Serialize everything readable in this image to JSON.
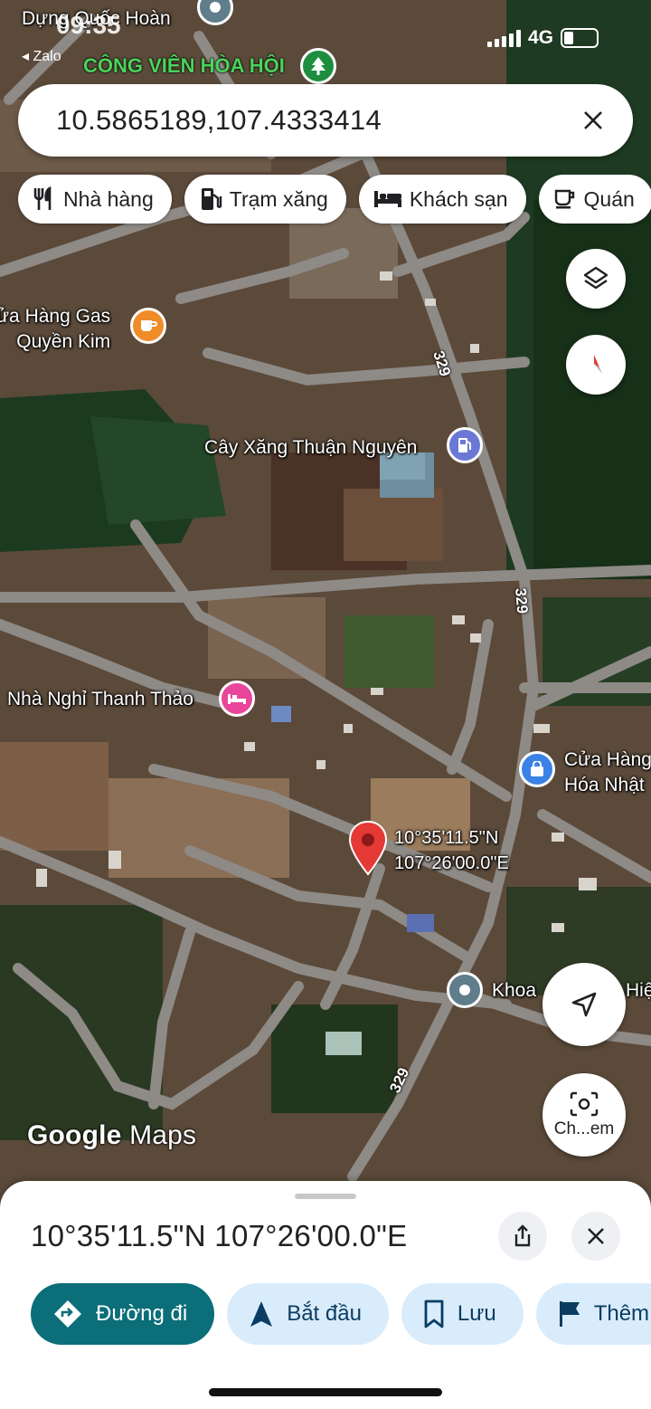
{
  "status_bar": {
    "time": "09:35",
    "back_app": "◂ Zalo",
    "network": "4G"
  },
  "search": {
    "value": "10.5865189,107.4333414"
  },
  "chips": [
    {
      "label": "Nhà hàng",
      "icon": "restaurant-icon"
    },
    {
      "label": "Trạm xăng",
      "icon": "gas-station-icon"
    },
    {
      "label": "Khách sạn",
      "icon": "hotel-icon"
    },
    {
      "label": "Quán",
      "icon": "cafe-icon"
    }
  ],
  "map": {
    "labels": {
      "top_store": "Dựng Quốc Hoàn",
      "park": "CÔNG VIÊN HÒA HỘI",
      "gas_shop_line1": "ửa Hàng Gas",
      "gas_shop_line2": "Quyền Kim",
      "gas_station": "Cây Xăng Thuận Nguyên",
      "guest_house": "Nhà Nghỉ Thanh Thảo",
      "store_line1": "Cửa Hàng",
      "store_line2": "Hóa Nhật",
      "pin_lat": "10°35'11.5\"N",
      "pin_lng": "107°26'00.0\"E",
      "khoa": "Khoa",
      "hie": "Hiệ"
    },
    "road_number": "329",
    "lens_label": "Ch...em",
    "logo_google": "Google",
    "logo_maps": "Maps"
  },
  "sheet": {
    "title": "10°35'11.5\"N 107°26'00.0\"E",
    "actions": [
      {
        "label": "Đường đi",
        "icon": "directions-icon"
      },
      {
        "label": "Bắt đầu",
        "icon": "navigation-arrow-icon"
      },
      {
        "label": "Lưu",
        "icon": "bookmark-icon"
      },
      {
        "label": "Thêm",
        "icon": "flag-icon"
      }
    ]
  },
  "colors": {
    "primary_action": "#0b6e78",
    "secondary_action": "#d9ecfb",
    "pin": "#e53935"
  }
}
